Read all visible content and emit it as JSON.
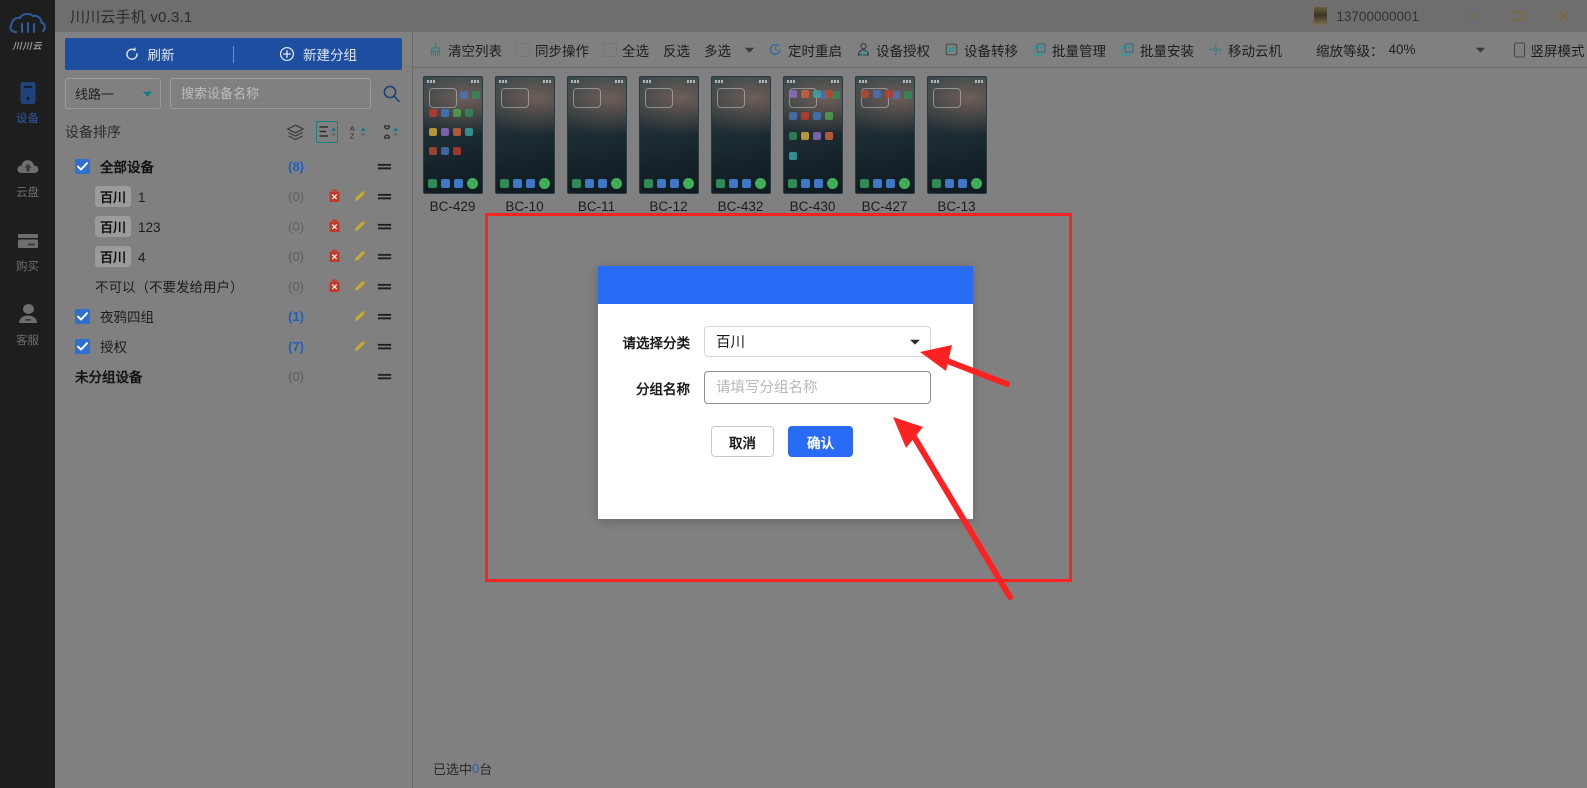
{
  "window": {
    "title": "川川云手机 v0.3.1",
    "account": "13700000001",
    "minimize_label": "最小化",
    "maximize_label": "最大化",
    "close_label": "关闭"
  },
  "rail": {
    "brand_word": "川川云",
    "items": [
      {
        "label": "设备",
        "icon": "device-icon",
        "active": true
      },
      {
        "label": "云盘",
        "icon": "cloud-disk-icon",
        "active": false
      },
      {
        "label": "购买",
        "icon": "purchase-card-icon",
        "active": false
      },
      {
        "label": "客服",
        "icon": "customer-service-icon",
        "active": false
      }
    ]
  },
  "left_panel": {
    "refresh_label": "刷新",
    "new_group_label": "新建分组",
    "line_select_value": "线路一",
    "search_placeholder": "搜索设备名称",
    "search_value": "",
    "sort_title": "设备排序",
    "sort_icons": [
      "layers-icon",
      "list-sort-icon",
      "alpha-sort-icon",
      "time-sort-icon"
    ],
    "groups": [
      {
        "checked": true,
        "badge": "",
        "name": "全部设备",
        "bold": true,
        "count": "(8)",
        "count_style": "blue",
        "has_delete": false,
        "has_edit": false,
        "child": false
      },
      {
        "checked": null,
        "badge": "百川",
        "name": "1",
        "bold": false,
        "count": "(0)",
        "count_style": "gray",
        "has_delete": true,
        "has_edit": true,
        "child": true
      },
      {
        "checked": null,
        "badge": "百川",
        "name": "123",
        "bold": false,
        "count": "(0)",
        "count_style": "gray",
        "has_delete": true,
        "has_edit": true,
        "child": true
      },
      {
        "checked": null,
        "badge": "百川",
        "name": "4",
        "bold": false,
        "count": "(0)",
        "count_style": "gray",
        "has_delete": true,
        "has_edit": true,
        "child": true
      },
      {
        "checked": null,
        "badge": "",
        "name": "不可以（不要发给用户）",
        "bold": false,
        "count": "(0)",
        "count_style": "gray",
        "has_delete": true,
        "has_edit": true,
        "child": true
      },
      {
        "checked": true,
        "badge": "",
        "name": "夜鸦四组",
        "bold": false,
        "count": "(1)",
        "count_style": "blue",
        "has_delete": false,
        "has_edit": true,
        "child": false
      },
      {
        "checked": true,
        "badge": "",
        "name": "授权",
        "bold": false,
        "count": "(7)",
        "count_style": "blue",
        "has_delete": false,
        "has_edit": true,
        "child": false
      },
      {
        "checked": null,
        "badge": "",
        "name": "未分组设备",
        "bold": true,
        "count": "(0)",
        "count_style": "gray",
        "has_delete": false,
        "has_edit": false,
        "child": false
      }
    ]
  },
  "toolbar": {
    "clear_list": "清空列表",
    "sync_operation": "同步操作",
    "select_all": "全选",
    "invert_select": "反选",
    "multi_select": "多选",
    "timed_restart": "定时重启",
    "device_authorize": "设备授权",
    "device_transfer": "设备转移",
    "batch_manage": "批量管理",
    "batch_install": "批量安装",
    "move_cloud_phone": "移动云机",
    "zoom_label": "缩放等级：",
    "zoom_value": "40%",
    "portrait_mode": "竖屏模式",
    "sync_checked": false,
    "select_all_checked": false,
    "portrait_checked": false
  },
  "devices": [
    {
      "name": "BC-429",
      "variant": "full"
    },
    {
      "name": "BC-10",
      "variant": "sparse"
    },
    {
      "name": "BC-11",
      "variant": "sparse"
    },
    {
      "name": "BC-12",
      "variant": "sparse"
    },
    {
      "name": "BC-432",
      "variant": "sparse"
    },
    {
      "name": "BC-430",
      "variant": "dense"
    },
    {
      "name": "BC-427",
      "variant": "mid"
    },
    {
      "name": "BC-13",
      "variant": "sparse"
    }
  ],
  "status_bar": {
    "prefix": "已选中",
    "count": "0",
    "suffix": "台"
  },
  "modal": {
    "title": "",
    "category_label": "请选择分类",
    "category_value": "百川",
    "group_name_label": "分组名称",
    "group_name_placeholder": "请填写分组名称",
    "group_name_value": "",
    "cancel_label": "取消",
    "confirm_label": "确认"
  },
  "colors": {
    "accent_blue": "#2a6bf5",
    "button_bar_blue": "#1d4ea0",
    "annotation_red": "#fd2222",
    "count_blue": "#1e5fbd",
    "rail_bg": "#1e1e1e",
    "panel_bg": "#808080",
    "titlebar_bg": "#6e6e6e"
  }
}
